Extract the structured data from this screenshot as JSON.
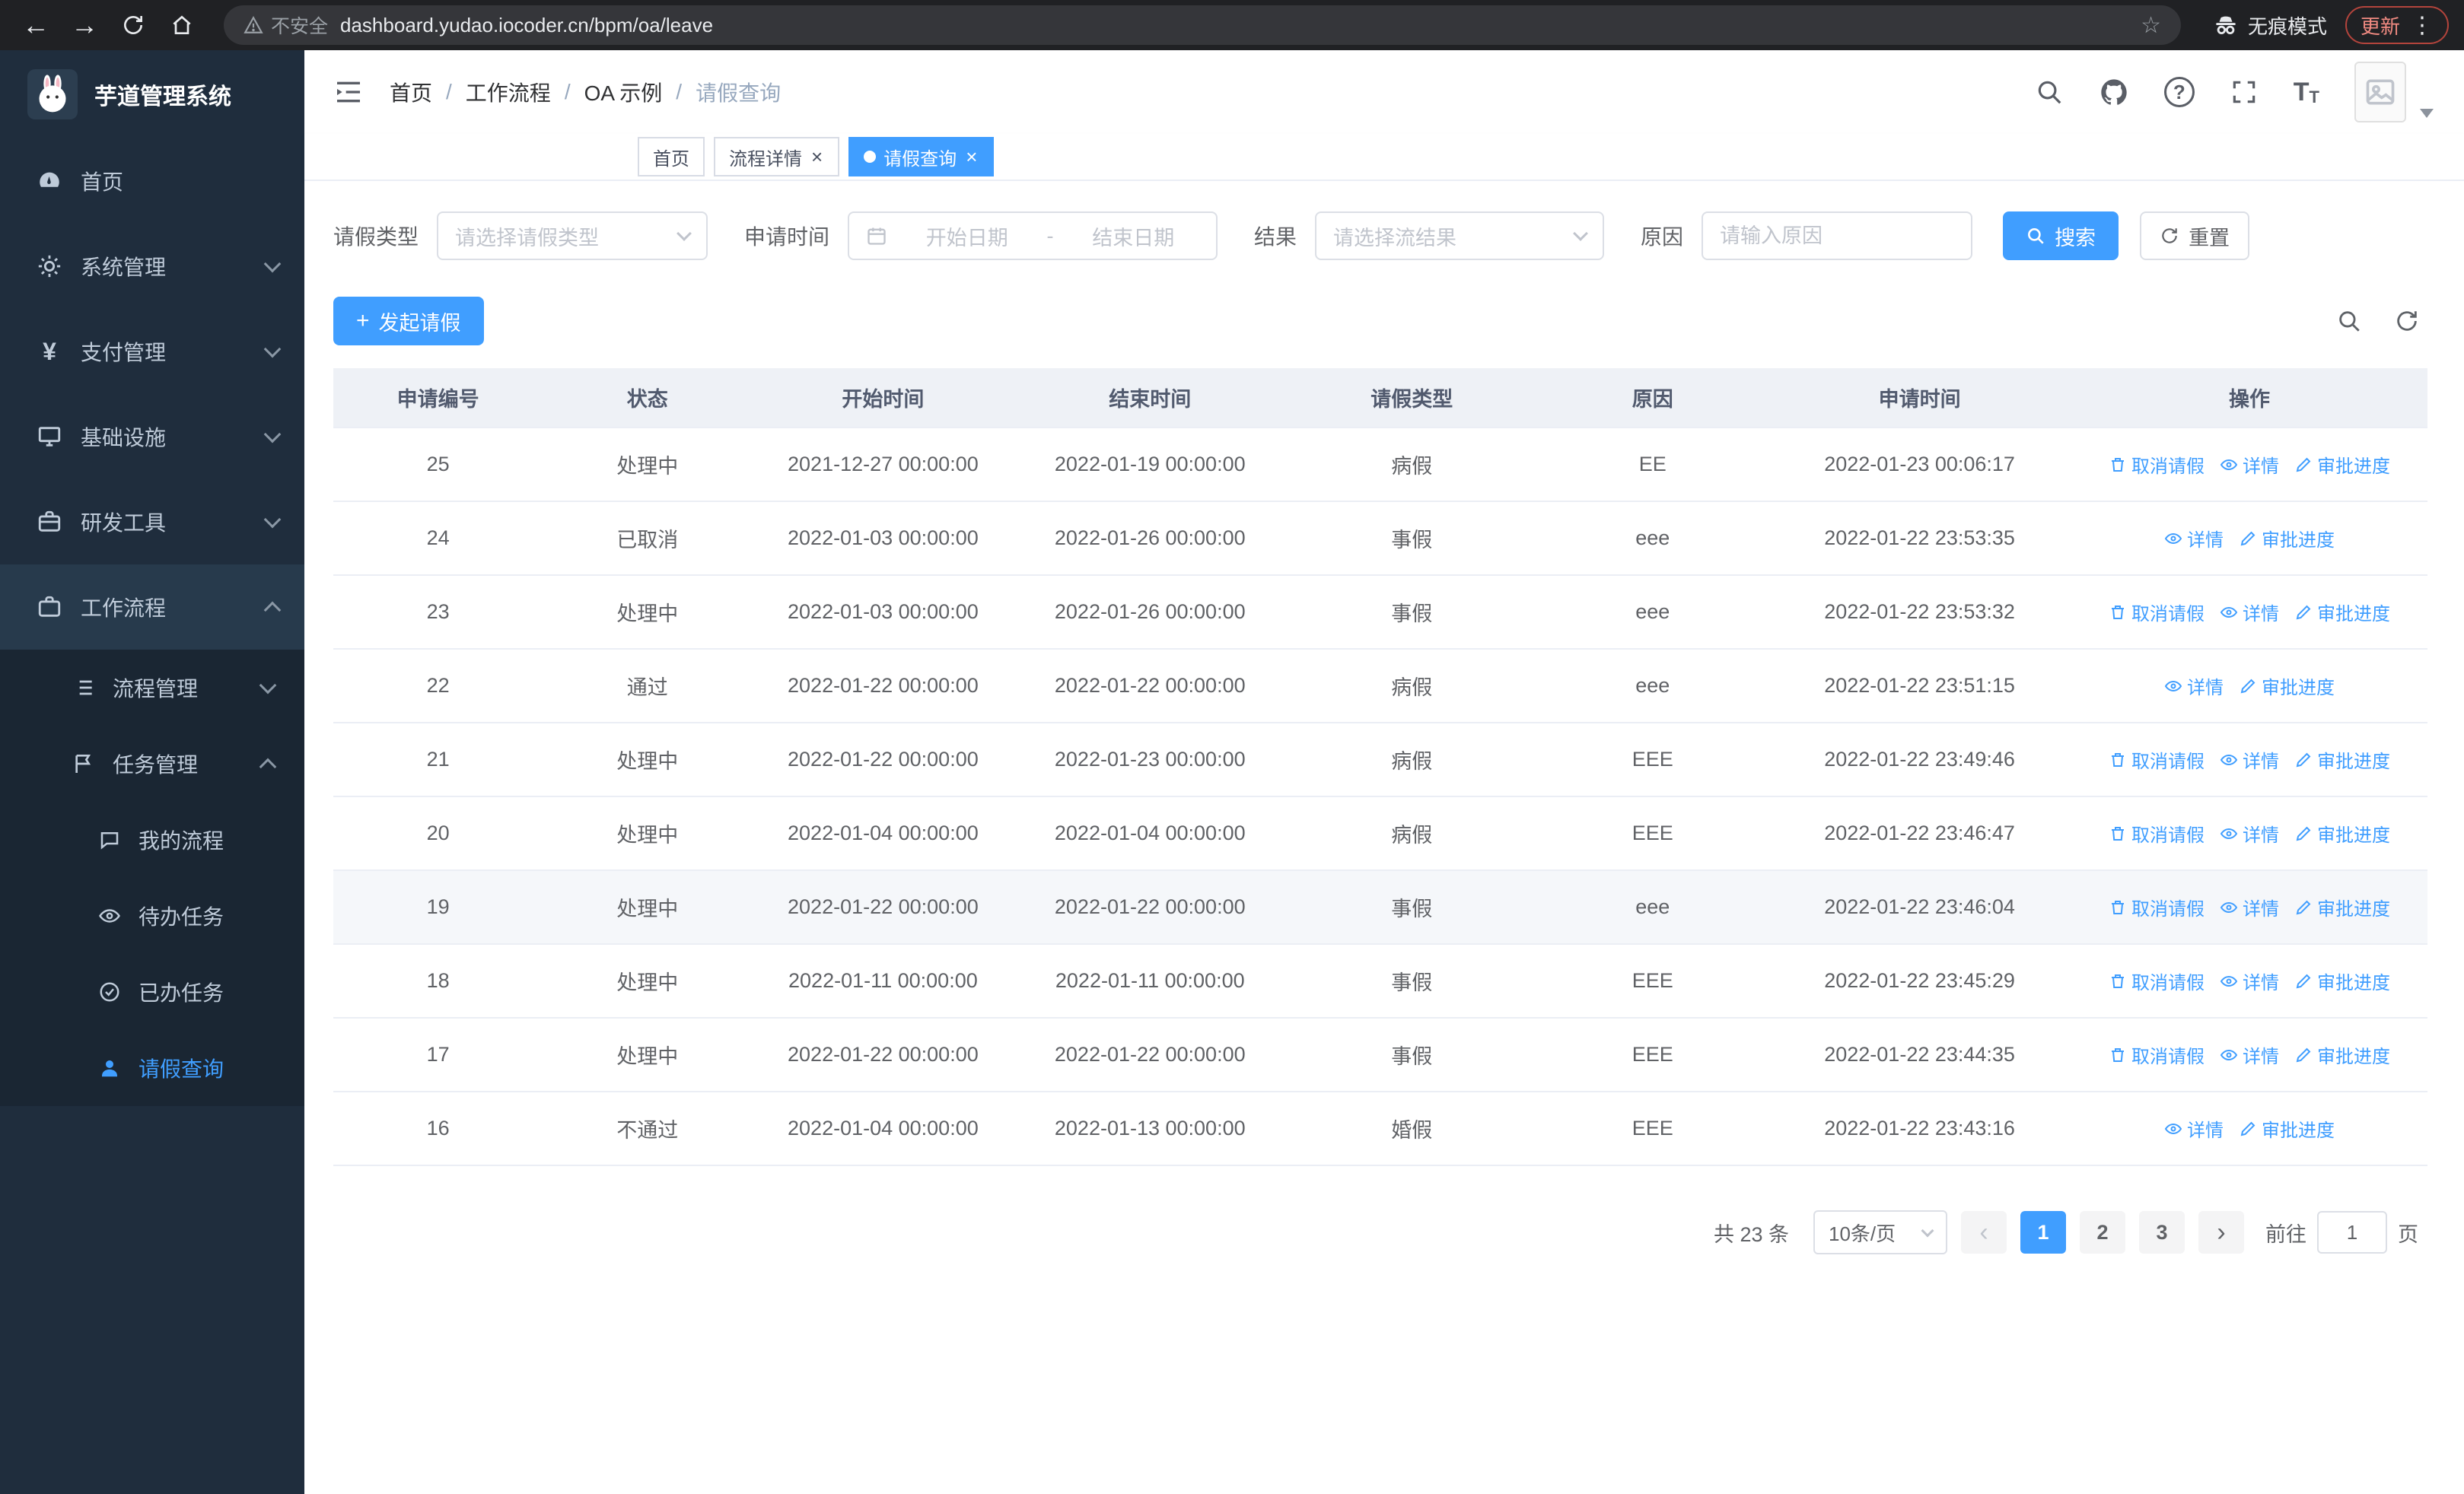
{
  "glyphs": {
    "back": "←",
    "forward": "→",
    "close": "×",
    "plus": "+",
    "star": "☆",
    "dots": "⋮",
    "prev": "‹",
    "next": "›",
    "slash": "/",
    "dash": "-",
    "yen": "¥",
    "question": "?",
    "big_t": "T",
    "small_t": "T"
  },
  "browser": {
    "security_label": "不安全",
    "url": "dashboard.yudao.iocoder.cn/bpm/oa/leave",
    "incognito_label": "无痕模式",
    "update_label": "更新"
  },
  "sidebar": {
    "logo_title": "芋道管理系统",
    "items": [
      {
        "label": "首页"
      },
      {
        "label": "系统管理"
      },
      {
        "label": "支付管理"
      },
      {
        "label": "基础设施"
      },
      {
        "label": "研发工具"
      },
      {
        "label": "工作流程"
      }
    ],
    "workflow_children": [
      {
        "label": "流程管理"
      },
      {
        "label": "任务管理"
      }
    ],
    "task_children": [
      {
        "label": "我的流程"
      },
      {
        "label": "待办任务"
      },
      {
        "label": "已办任务"
      },
      {
        "label": "请假查询"
      }
    ]
  },
  "header": {
    "breadcrumbs": [
      "首页",
      "工作流程",
      "OA 示例",
      "请假查询"
    ]
  },
  "tabs": [
    {
      "label": "首页"
    },
    {
      "label": "流程详情"
    },
    {
      "label": "请假查询"
    }
  ],
  "filters": {
    "leave_type_label": "请假类型",
    "leave_type_placeholder": "请选择请假类型",
    "apply_time_label": "申请时间",
    "date_start_placeholder": "开始日期",
    "date_end_placeholder": "结束日期",
    "result_label": "结果",
    "result_placeholder": "请选择流结果",
    "reason_label": "原因",
    "reason_placeholder": "请输入原因",
    "search_button": "搜索",
    "reset_button": "重置"
  },
  "toolbar": {
    "create_button": "发起请假"
  },
  "table": {
    "columns": [
      "申请编号",
      "状态",
      "开始时间",
      "结束时间",
      "请假类型",
      "原因",
      "申请时间",
      "操作"
    ],
    "action_labels": {
      "cancel": "取消请假",
      "detail": "详情",
      "progress": "审批进度"
    },
    "rows": [
      {
        "id": "25",
        "status": "处理中",
        "start": "2021-12-27 00:00:00",
        "end": "2022-01-19 00:00:00",
        "type": "病假",
        "reason": "EE",
        "apply_time": "2022-01-23 00:06:17",
        "cancellable": true,
        "hover": false
      },
      {
        "id": "24",
        "status": "已取消",
        "start": "2022-01-03 00:00:00",
        "end": "2022-01-26 00:00:00",
        "type": "事假",
        "reason": "eee",
        "apply_time": "2022-01-22 23:53:35",
        "cancellable": false,
        "hover": false
      },
      {
        "id": "23",
        "status": "处理中",
        "start": "2022-01-03 00:00:00",
        "end": "2022-01-26 00:00:00",
        "type": "事假",
        "reason": "eee",
        "apply_time": "2022-01-22 23:53:32",
        "cancellable": true,
        "hover": false
      },
      {
        "id": "22",
        "status": "通过",
        "start": "2022-01-22 00:00:00",
        "end": "2022-01-22 00:00:00",
        "type": "病假",
        "reason": "eee",
        "apply_time": "2022-01-22 23:51:15",
        "cancellable": false,
        "hover": false
      },
      {
        "id": "21",
        "status": "处理中",
        "start": "2022-01-22 00:00:00",
        "end": "2022-01-23 00:00:00",
        "type": "病假",
        "reason": "EEE",
        "apply_time": "2022-01-22 23:49:46",
        "cancellable": true,
        "hover": false
      },
      {
        "id": "20",
        "status": "处理中",
        "start": "2022-01-04 00:00:00",
        "end": "2022-01-04 00:00:00",
        "type": "病假",
        "reason": "EEE",
        "apply_time": "2022-01-22 23:46:47",
        "cancellable": true,
        "hover": false
      },
      {
        "id": "19",
        "status": "处理中",
        "start": "2022-01-22 00:00:00",
        "end": "2022-01-22 00:00:00",
        "type": "事假",
        "reason": "eee",
        "apply_time": "2022-01-22 23:46:04",
        "cancellable": true,
        "hover": true
      },
      {
        "id": "18",
        "status": "处理中",
        "start": "2022-01-11 00:00:00",
        "end": "2022-01-11 00:00:00",
        "type": "事假",
        "reason": "EEE",
        "apply_time": "2022-01-22 23:45:29",
        "cancellable": true,
        "hover": false
      },
      {
        "id": "17",
        "status": "处理中",
        "start": "2022-01-22 00:00:00",
        "end": "2022-01-22 00:00:00",
        "type": "事假",
        "reason": "EEE",
        "apply_time": "2022-01-22 23:44:35",
        "cancellable": true,
        "hover": false
      },
      {
        "id": "16",
        "status": "不通过",
        "start": "2022-01-04 00:00:00",
        "end": "2022-01-13 00:00:00",
        "type": "婚假",
        "reason": "EEE",
        "apply_time": "2022-01-22 23:43:16",
        "cancellable": false,
        "hover": false
      }
    ]
  },
  "pagination": {
    "total_text": "共 23 条",
    "page_size": "10条/页",
    "pages": [
      "1",
      "2",
      "3"
    ],
    "active_page": "1",
    "goto_label": "前往",
    "goto_value": "1",
    "goto_suffix": "页"
  },
  "colors": {
    "primary": "#409eff",
    "sidebar_bg": "#1f2d3d",
    "table_header_bg": "#eef1f6",
    "danger": "#f28b82"
  }
}
